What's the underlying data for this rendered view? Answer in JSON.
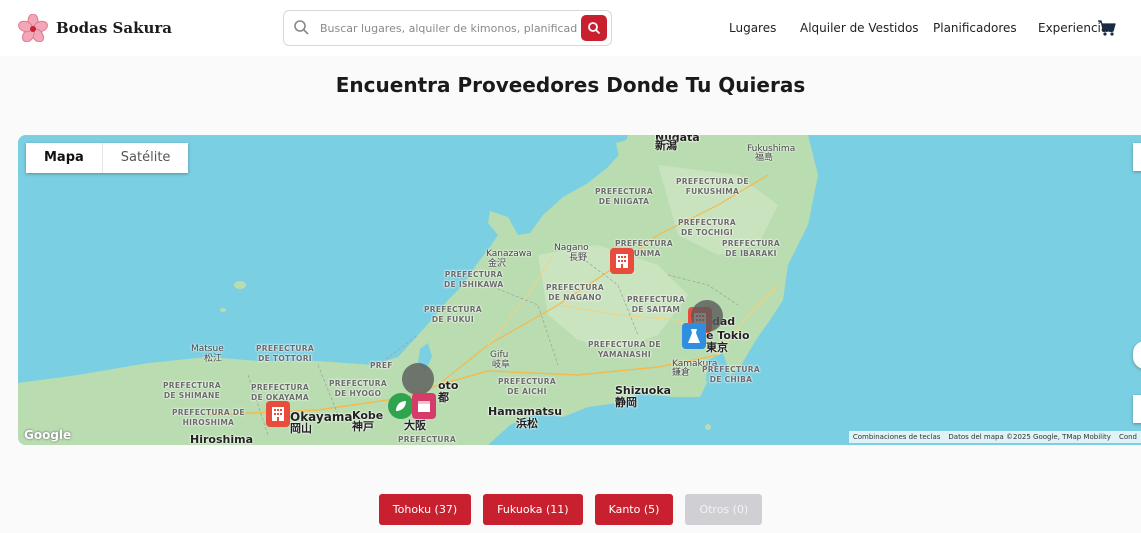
{
  "brand": {
    "name": "Bodas Sakura",
    "accent": "#c8202f"
  },
  "search": {
    "placeholder": "Buscar lugares, alquiler de kimonos, planificadores",
    "icon": "search-icon"
  },
  "nav": {
    "items": [
      "Lugares",
      "Alquiler de Vestidos",
      "Planificadores",
      "Experiencias"
    ],
    "cart_icon": "cart-icon"
  },
  "page_title": "Encuentra Proveedores Donde Tu Quieras",
  "map": {
    "type_buttons": [
      "Mapa",
      "Satélite"
    ],
    "selected_type": "Mapa",
    "google_logo": "Google",
    "attribution": [
      "Combinaciones de teclas",
      "Datos del mapa ©2025 Google, TMap Mobility",
      "Cond"
    ],
    "cities": {
      "niigata": "Niigata",
      "niigata_jp": "新潟",
      "fukushima": "Fukushima",
      "fukushima_jp": "福島",
      "kanazawa": "Kanazawa",
      "kanazawa_jp": "金沢",
      "nagano": "Nagano",
      "nagano_jp": "長野",
      "gifu": "Gifu",
      "gifu_jp": "岐阜",
      "matsue": "Matsue",
      "matsue_jp": "松江",
      "okayama": "Okayama",
      "okayama_jp": "岡山",
      "kobe": "Kobe",
      "kobe_jp": "神戸",
      "osaka_jp": "大阪",
      "kyoto": "oto",
      "kyoto_jp": "都",
      "hamamatsu": "Hamamatsu",
      "hamamatsu_jp": "浜松",
      "shizuoka": "Shizuoka",
      "shizuoka_jp": "静岡",
      "tokyo": "dad",
      "tokyo2": "e Tokio",
      "tokyo_jp": "東京",
      "kamakura": "Kamakura",
      "kamakura_jp": "鎌倉",
      "hiroshima": "Hiroshima"
    },
    "prefectures": {
      "niigata": [
        "PREFECTURA",
        "DE NIIGATA"
      ],
      "fukushima": [
        "PREFECTURA DE",
        "FUKUSHIMA"
      ],
      "tochigi": [
        "PREFECTURA",
        "DE TOCHIGI"
      ],
      "ibaraki": [
        "PREFECTURA",
        "DE IBARAKI"
      ],
      "gunma": [
        "PREFECTURA",
        "GUNMA"
      ],
      "ishikawa": [
        "PREFECTURA",
        "DE ISHIKAWA"
      ],
      "nagano": [
        "PREFECTURA",
        "DE NAGANO"
      ],
      "fukui": [
        "PREFECTURA",
        "DE FUKUI"
      ],
      "saitama": [
        "PREFECTURA",
        "DE SAITAM"
      ],
      "yamanashi": [
        "PREFECTURA DE",
        "YAMANASHI"
      ],
      "chiba": [
        "PREFECTURA",
        "DE CHIBA"
      ],
      "tottori": [
        "PREFECTURA",
        "DE TOTTORI"
      ],
      "shimane": [
        "PREFECTURA",
        "DE SHIMANE"
      ],
      "okayama": [
        "PREFECTURA",
        "DE OKAYAMA"
      ],
      "hyogo": [
        "PREFECTURA",
        "DE HYOGO"
      ],
      "aichi": [
        "PREFECTURA",
        "DE AICHI"
      ],
      "hiroshima": [
        "PREFECTURA DE",
        "HIROSHIMA"
      ],
      "kyoto": [
        "PREF"
      ],
      "osaka": [
        "PREFECTURA"
      ]
    }
  },
  "filters": [
    {
      "label": "Tohoku (37)",
      "enabled": true
    },
    {
      "label": "Fukuoka (11)",
      "enabled": true
    },
    {
      "label": "Kanto (5)",
      "enabled": true
    },
    {
      "label": "Otros (0)",
      "enabled": false
    }
  ],
  "colors": {
    "water": "#7bcfe2",
    "land": "#b9dcb0",
    "marker_red": "#e84c3d",
    "marker_blue": "#2f8ee0",
    "marker_pink": "#d43d6a",
    "marker_green": "#2ea44f"
  }
}
